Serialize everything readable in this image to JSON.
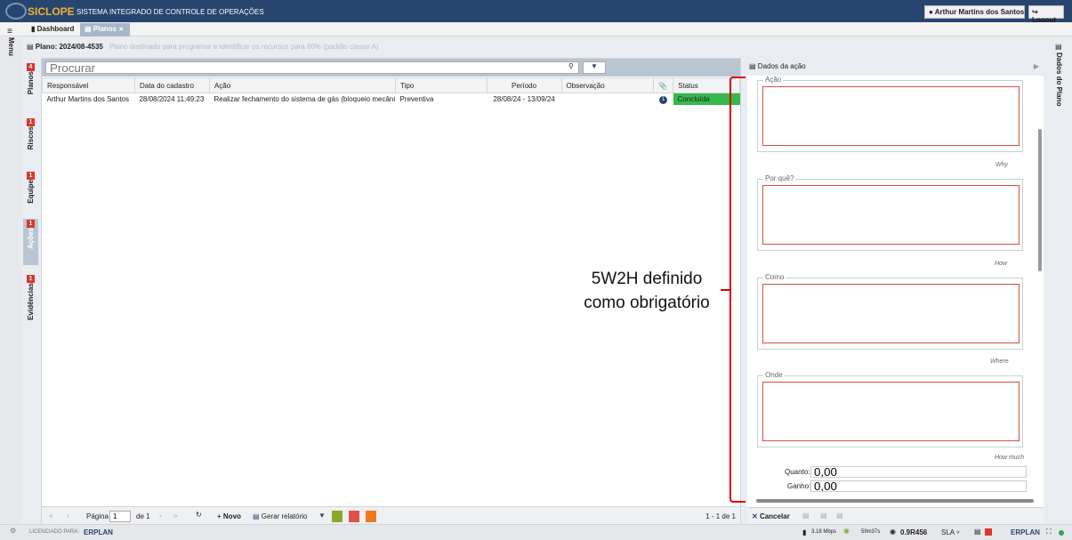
{
  "header": {
    "brand": "SICLOPE",
    "system_name": "SISTEMA INTEGRADO DE CONTROLE DE OPERAÇÕES",
    "user_name": "Arthur Martins dos Santos",
    "logout_label": "Logout"
  },
  "tabs": [
    {
      "label": "Dashboard"
    },
    {
      "label": "Planos"
    }
  ],
  "menu_label": "Menu",
  "plan": {
    "title": "Plano: 2024/08-4535",
    "description": "Plano destinado para programar e identificar os recursos para 80% (padrão classe A)"
  },
  "side_tabs": [
    {
      "label": "Planos",
      "badge": "4"
    },
    {
      "label": "Riscos",
      "badge": "1"
    },
    {
      "label": "Equipe",
      "badge": "1"
    },
    {
      "label": "Ações",
      "badge": "1"
    },
    {
      "label": "Evidências",
      "badge": "1"
    }
  ],
  "search": {
    "placeholder": "Procurar"
  },
  "table": {
    "columns": [
      "Responsável",
      "Data do cadastro",
      "Ação",
      "Tipo",
      "Período",
      "Observação",
      "",
      "Status"
    ],
    "rows": [
      {
        "responsavel": "Arthur Martins dos Santos",
        "data": "28/08/2024 11:49:23",
        "acao": "Realizar fechamento do sistema de gás (bloqueio mecânic...",
        "tipo": "Preventiva",
        "periodo": "28/08/24 - 13/09/24",
        "observacao": "",
        "anexos": "1",
        "status": "Concluída",
        "status_color": "#36b94a"
      }
    ]
  },
  "pager": {
    "page_label": "Página",
    "page_value": "1",
    "of_label": "de 1",
    "new_label": "Novo",
    "report_label": "Gerar relatório",
    "count_label": "1 - 1 de 1"
  },
  "panel": {
    "title": "Dados da ação",
    "right_tab_label": "Dados do Plano",
    "fields": [
      {
        "label": "Ação",
        "hint": "Why"
      },
      {
        "label": "Por quê?",
        "hint": "How"
      },
      {
        "label": "Como",
        "hint": "Where"
      },
      {
        "label": "Onde",
        "hint": "How much"
      }
    ],
    "quanto_label": "Quanto:",
    "quanto_value": "0,00",
    "ganho_label": "Ganho:",
    "ganho_value": "0,00",
    "cancel_label": "Cancelar"
  },
  "annotation": {
    "line1": "5W2H definido",
    "line2": "como obrigatório",
    "color": "#d00000"
  },
  "footer": {
    "licensed": "LICENCIADO PARA:",
    "company": "ERPLAN",
    "speed": "3.18 Mbps",
    "time": "59m37s",
    "version": "0.9R456",
    "sla": "SLA"
  },
  "colors": {
    "topbar": "#27456f",
    "accent": "#f2b233",
    "required_border": "#d84e3e"
  }
}
